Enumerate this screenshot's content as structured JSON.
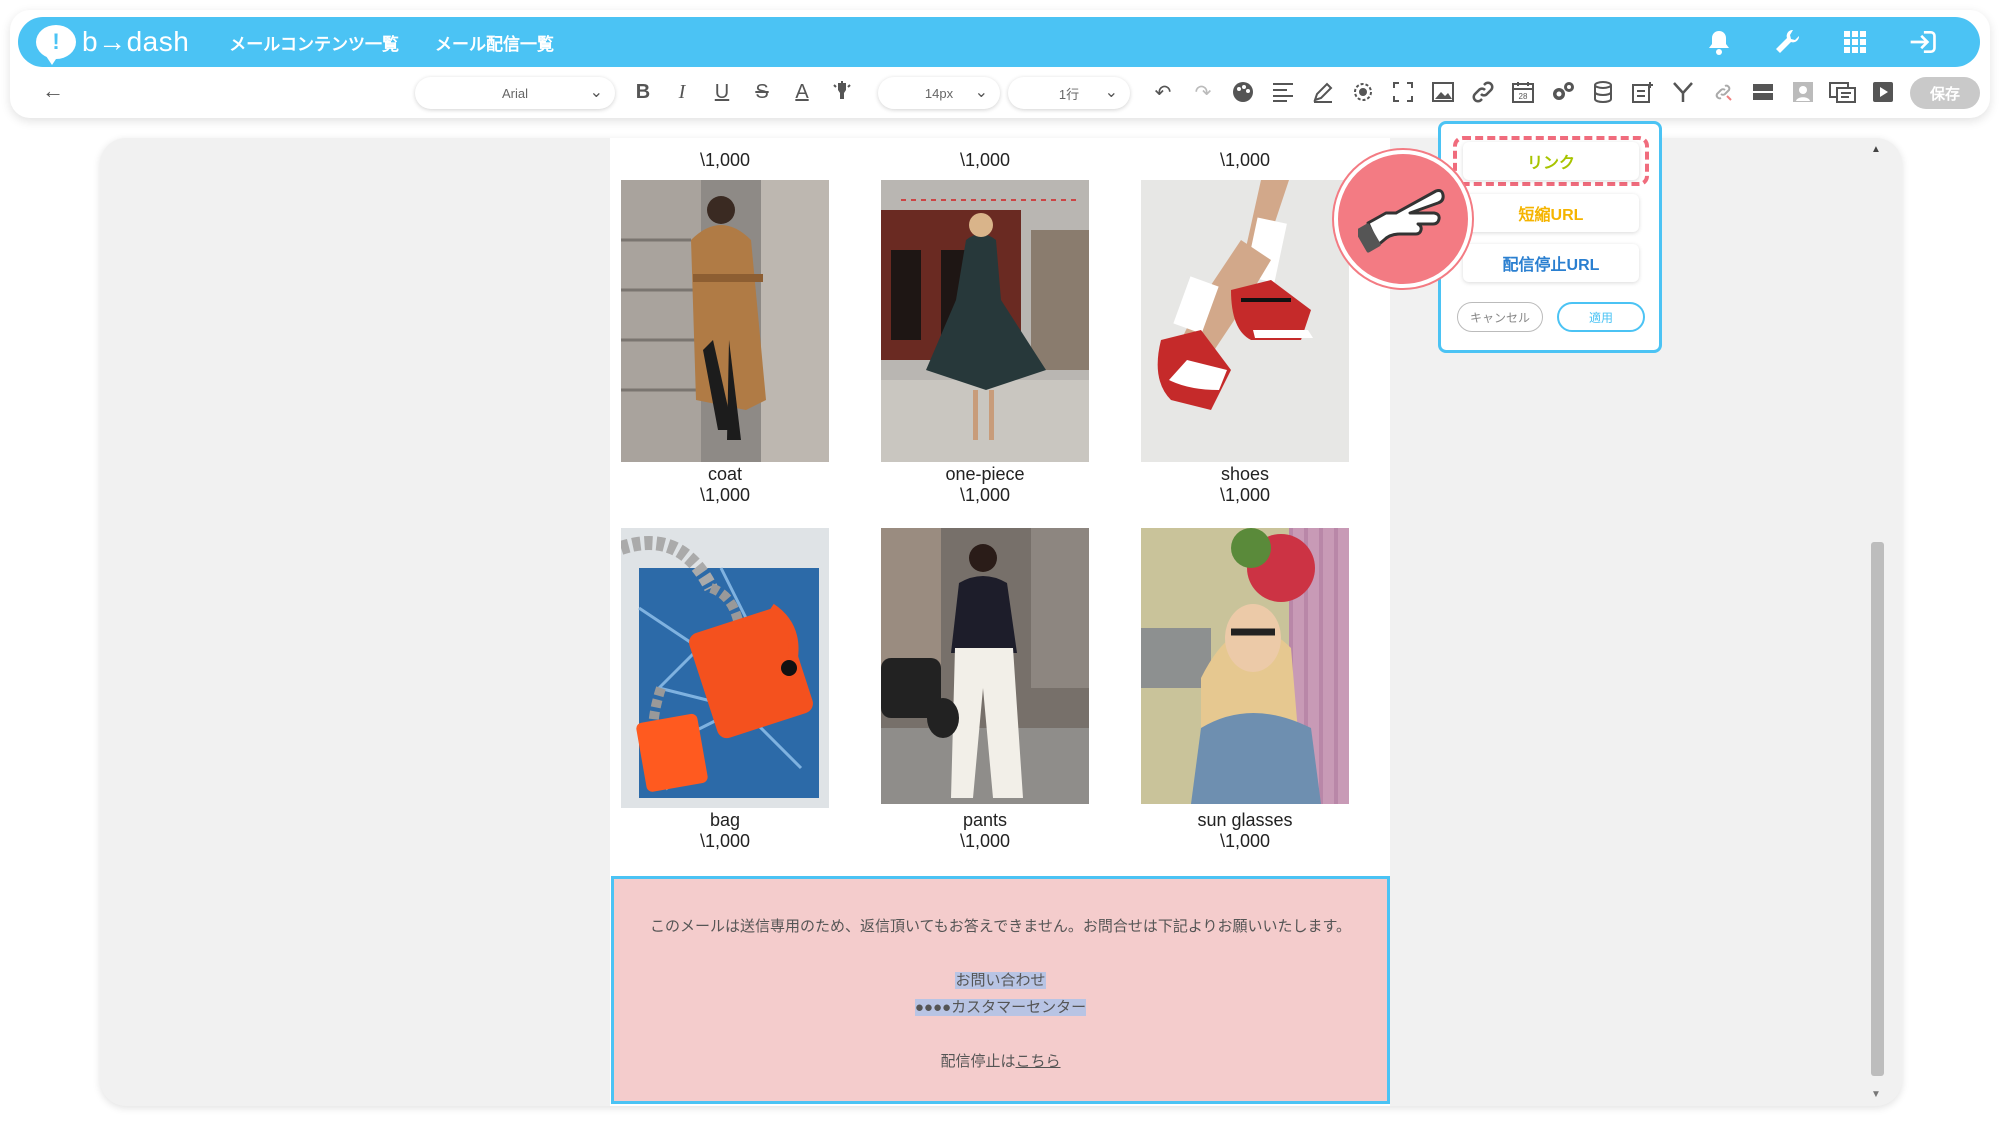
{
  "header": {
    "logo_text": "b→dash",
    "nav": [
      "メールコンテンツ一覧",
      "メール配信一覧"
    ]
  },
  "toolbar": {
    "font_family": "Arial",
    "font_size": "14px",
    "line_height": "1行",
    "save_label": "保存"
  },
  "email": {
    "top_row_prices": [
      "\\1,000",
      "\\1,000",
      "\\1,000"
    ],
    "row1": [
      {
        "name": "coat",
        "price": "\\1,000"
      },
      {
        "name": "one-piece",
        "price": "\\1,000"
      },
      {
        "name": "shoes",
        "price": "\\1,000"
      }
    ],
    "row2": [
      {
        "name": "bag",
        "price": "\\1,000"
      },
      {
        "name": "pants",
        "price": "\\1,000"
      },
      {
        "name": "sun glasses",
        "price": "\\1,000"
      }
    ],
    "footer": {
      "notice": "このメールは送信専用のため、返信頂いてもお答えできません。お問合せは下記よりお願いいたします。",
      "contact_label": "お問い合わせ",
      "center_name": "●●●●カスタマーセンター",
      "unsubscribe_prefix": "配信停止は",
      "unsubscribe_link": "こちら"
    }
  },
  "link_popup": {
    "options": [
      "リンク",
      "短縮URL",
      "配信停止URL"
    ],
    "cancel": "キャンセル",
    "apply": "適用"
  },
  "colors": {
    "brand": "#4bc3f4",
    "link_option": "#a8c400",
    "short_url_option": "#f5b400",
    "unsubscribe_option": "#2a7fd0",
    "highlight": "#f06c7d",
    "footer_bg": "#f4cccc"
  }
}
